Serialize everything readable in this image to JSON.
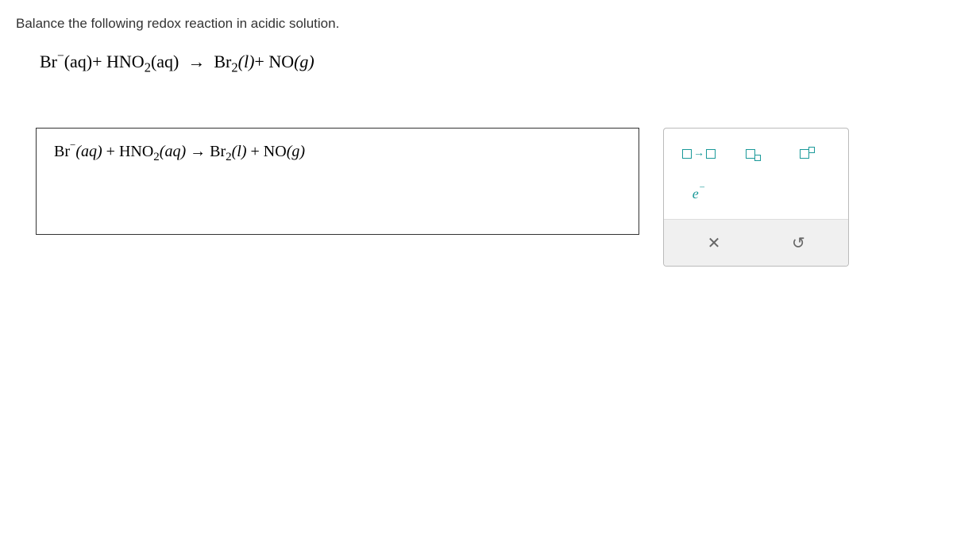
{
  "question": {
    "prompt": "Balance the following redox reaction in acidic solution.",
    "equation_parts": {
      "br_minus": "Br",
      "br_charge": "−",
      "aq1": "(aq)",
      "plus1": "+",
      "hno2": "HNO",
      "hno2_sub": "2",
      "aq2": "(aq)",
      "arrow": "→",
      "br2": "Br",
      "br2_sub": "2",
      "l": "(l)",
      "plus2": "+",
      "no": "NO",
      "g": "(g)"
    }
  },
  "answer": {
    "br_minus": "Br",
    "br_charge": "−",
    "aq1": "(aq)",
    "plus1": " + ",
    "hno2": "HNO",
    "hno2_sub": "2",
    "aq2": "(aq)",
    "arrow": " → ",
    "br2": "Br",
    "br2_sub": "2",
    "l": "(l)",
    "plus2": " + ",
    "no": "NO",
    "g": "(g)"
  },
  "tools": {
    "electron_label": "e",
    "electron_charge": "−",
    "clear_icon": "✕",
    "undo_icon": "↻"
  }
}
